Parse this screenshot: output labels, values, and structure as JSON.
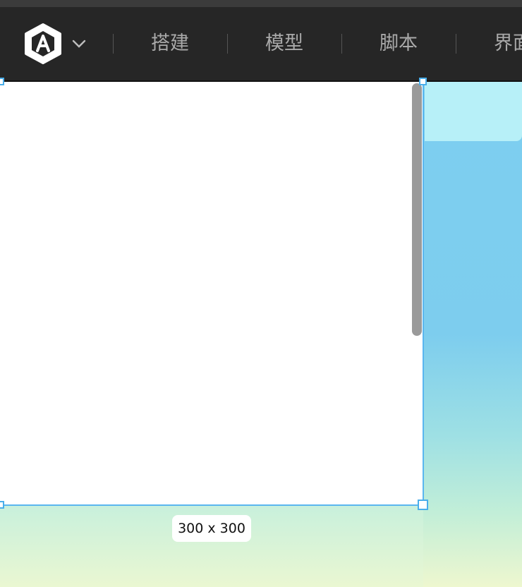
{
  "toolbar": {
    "logo_icon": "hexagon-a-logo-icon",
    "dropdown_icon": "chevron-down-icon",
    "tabs": [
      {
        "label": "搭建"
      },
      {
        "label": "模型"
      },
      {
        "label": "脚本"
      },
      {
        "label": "界面"
      }
    ]
  },
  "canvas": {
    "frame_size_label": "300 x 300"
  },
  "colors": {
    "toolbar_bg": "#262626",
    "tab_text": "#a9a9a9",
    "selection": "#5ab6ef",
    "sky": "#7dcff0"
  }
}
